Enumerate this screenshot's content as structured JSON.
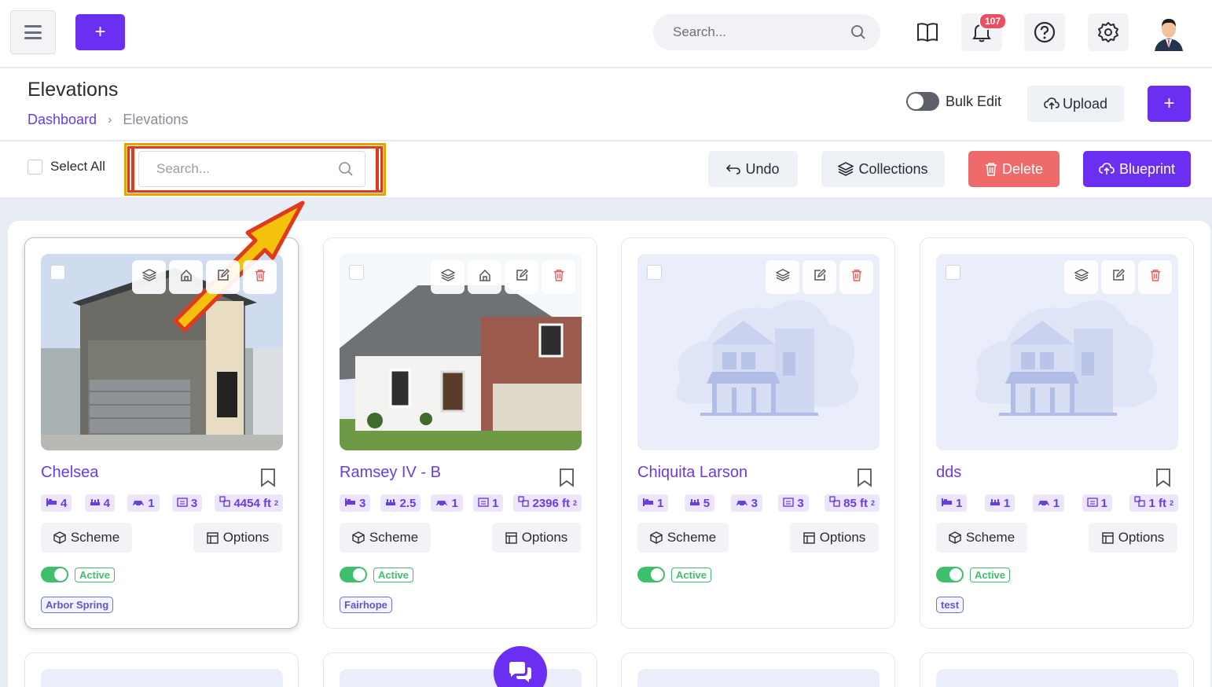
{
  "topbar": {
    "search_placeholder": "Search...",
    "notification_count": "107",
    "icons": [
      "menu-icon",
      "plus-icon",
      "search-icon",
      "book-icon",
      "bell-icon",
      "help-icon",
      "gear-icon",
      "avatar"
    ]
  },
  "header": {
    "title": "Elevations",
    "breadcrumb": {
      "home": "Dashboard",
      "separator": "›",
      "current": "Elevations"
    },
    "bulk_edit_label": "Bulk Edit",
    "upload_label": "Upload",
    "add_label": "+"
  },
  "toolbar": {
    "select_all_label": "Select All",
    "search_placeholder": "Search...",
    "undo_label": "Undo",
    "collections_label": "Collections",
    "delete_label": "Delete",
    "blueprint_label": "Blueprint"
  },
  "cards": [
    {
      "name": "Chelsea",
      "beds": "4",
      "baths": "4",
      "garage": "1",
      "stories": "3",
      "sqft": "4454 ft",
      "scheme": "Scheme",
      "options": "Options",
      "status": "Active",
      "community": "Arbor Spring"
    },
    {
      "name": "Ramsey IV - B",
      "beds": "3",
      "baths": "2.5",
      "garage": "1",
      "stories": "1",
      "sqft": "2396 ft",
      "scheme": "Scheme",
      "options": "Options",
      "status": "Active",
      "community": "Fairhope"
    },
    {
      "name": "Chiquita Larson",
      "beds": "1",
      "baths": "5",
      "garage": "3",
      "stories": "3",
      "sqft": "85 ft",
      "scheme": "Scheme",
      "options": "Options",
      "status": "Active",
      "community": ""
    },
    {
      "name": "dds",
      "beds": "1",
      "baths": "1",
      "garage": "1",
      "stories": "1",
      "sqft": "1 ft",
      "scheme": "Scheme",
      "options": "Options",
      "status": "Active",
      "community": "test"
    }
  ],
  "sqft_unit_sup": "2",
  "colors": {
    "accent": "#6b2ff2",
    "danger": "#ef6a6a",
    "success": "#3dbf6b",
    "highlight": "#e8a300"
  }
}
